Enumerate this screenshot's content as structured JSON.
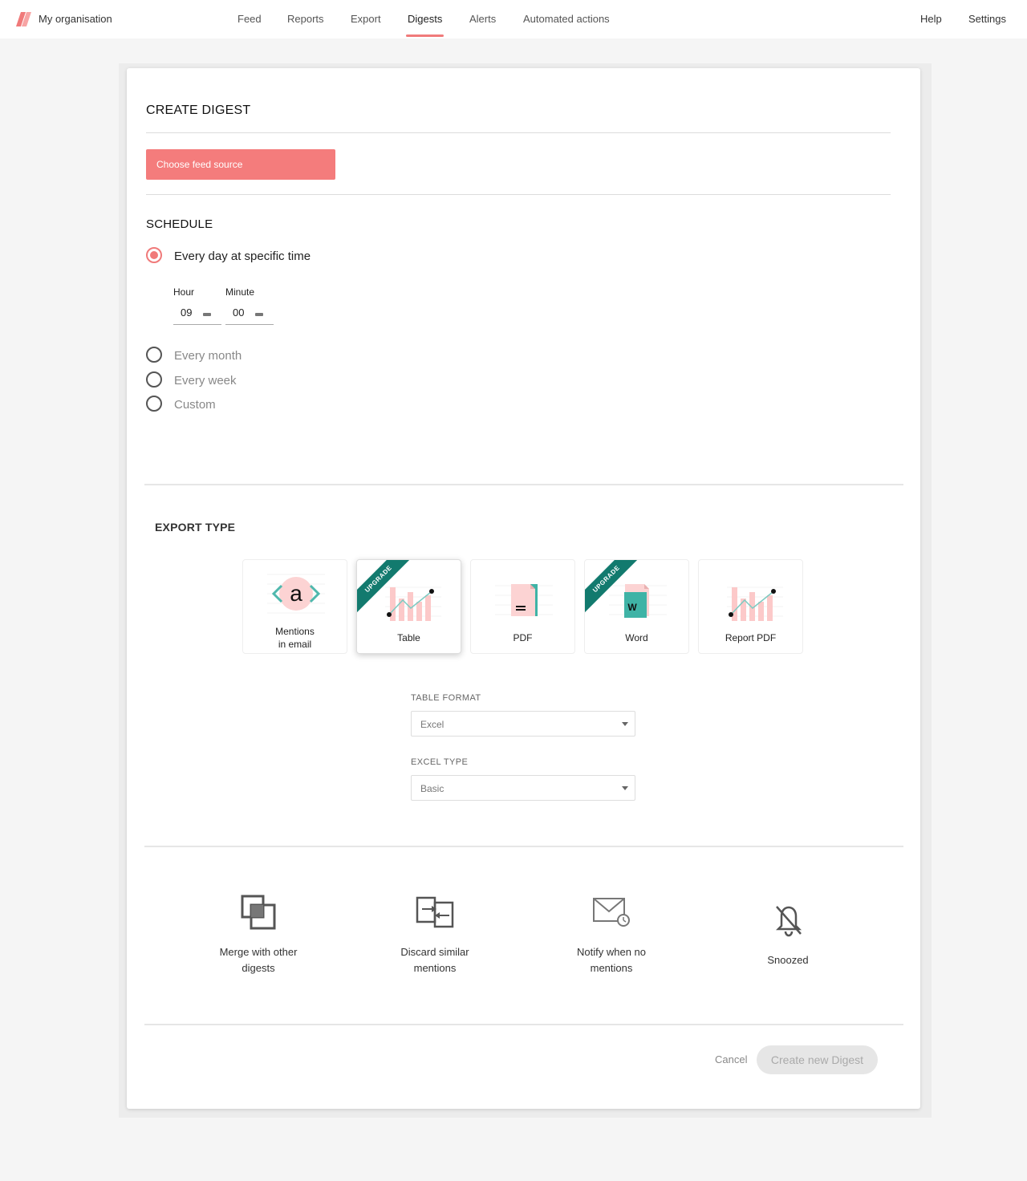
{
  "header": {
    "org_name": "My organisation",
    "nav": [
      {
        "label": "Feed"
      },
      {
        "label": "Reports"
      },
      {
        "label": "Export"
      },
      {
        "label": "Digests"
      },
      {
        "label": "Alerts"
      },
      {
        "label": "Automated actions"
      }
    ],
    "active_nav": "Digests",
    "help": "Help",
    "settings": "Settings",
    "brand_color": "#f07a7a"
  },
  "create_digest": {
    "title": "CREATE DIGEST",
    "feed_button": "Choose feed source"
  },
  "schedule": {
    "title": "SCHEDULE",
    "options": [
      {
        "label": "Every day at specific time",
        "checked": true
      },
      {
        "label": "Every month",
        "checked": false
      },
      {
        "label": "Every week",
        "checked": false
      },
      {
        "label": "Custom",
        "checked": false
      }
    ],
    "hour_label": "Hour",
    "hour_value": "09",
    "minute_label": "Minute",
    "minute_value": "00"
  },
  "export_type": {
    "title": "EXPORT TYPE",
    "tiles": [
      {
        "label_line1": "Mentions",
        "label_line2": "in email",
        "icon": "mentions-email-icon",
        "upgrade": false,
        "selected": false
      },
      {
        "label_line1": "Table",
        "label_line2": "",
        "icon": "table-chart-icon",
        "upgrade": true,
        "upgrade_text": "UPGRADE",
        "selected": true
      },
      {
        "label_line1": "PDF",
        "label_line2": "",
        "icon": "pdf-document-icon",
        "upgrade": false,
        "selected": false
      },
      {
        "label_line1": "Word",
        "label_line2": "",
        "icon": "word-document-icon",
        "upgrade": true,
        "upgrade_text": "UPGRADE",
        "selected": false
      },
      {
        "label_line1": "Report PDF",
        "label_line2": "",
        "icon": "report-chart-icon",
        "upgrade": false,
        "selected": false
      }
    ],
    "word_letter": "W",
    "mention_letter": "a",
    "ribbon_color": "#127a6e",
    "table_format": {
      "label": "TABLE FORMAT",
      "value": "Excel"
    },
    "excel_type": {
      "label": "EXCEL TYPE",
      "value": "Basic"
    }
  },
  "options": [
    {
      "line1": "Merge with other",
      "line2": "digests",
      "icon": "merge-icon"
    },
    {
      "line1": "Discard similar",
      "line2": "mentions",
      "icon": "discard-similar-icon"
    },
    {
      "line1": "Notify when no",
      "line2": "mentions",
      "icon": "envelope-clock-icon"
    },
    {
      "line1": "Snoozed",
      "line2": "",
      "icon": "bell-off-icon"
    }
  ],
  "footer": {
    "cancel": "Cancel",
    "create": "Create new Digest"
  }
}
